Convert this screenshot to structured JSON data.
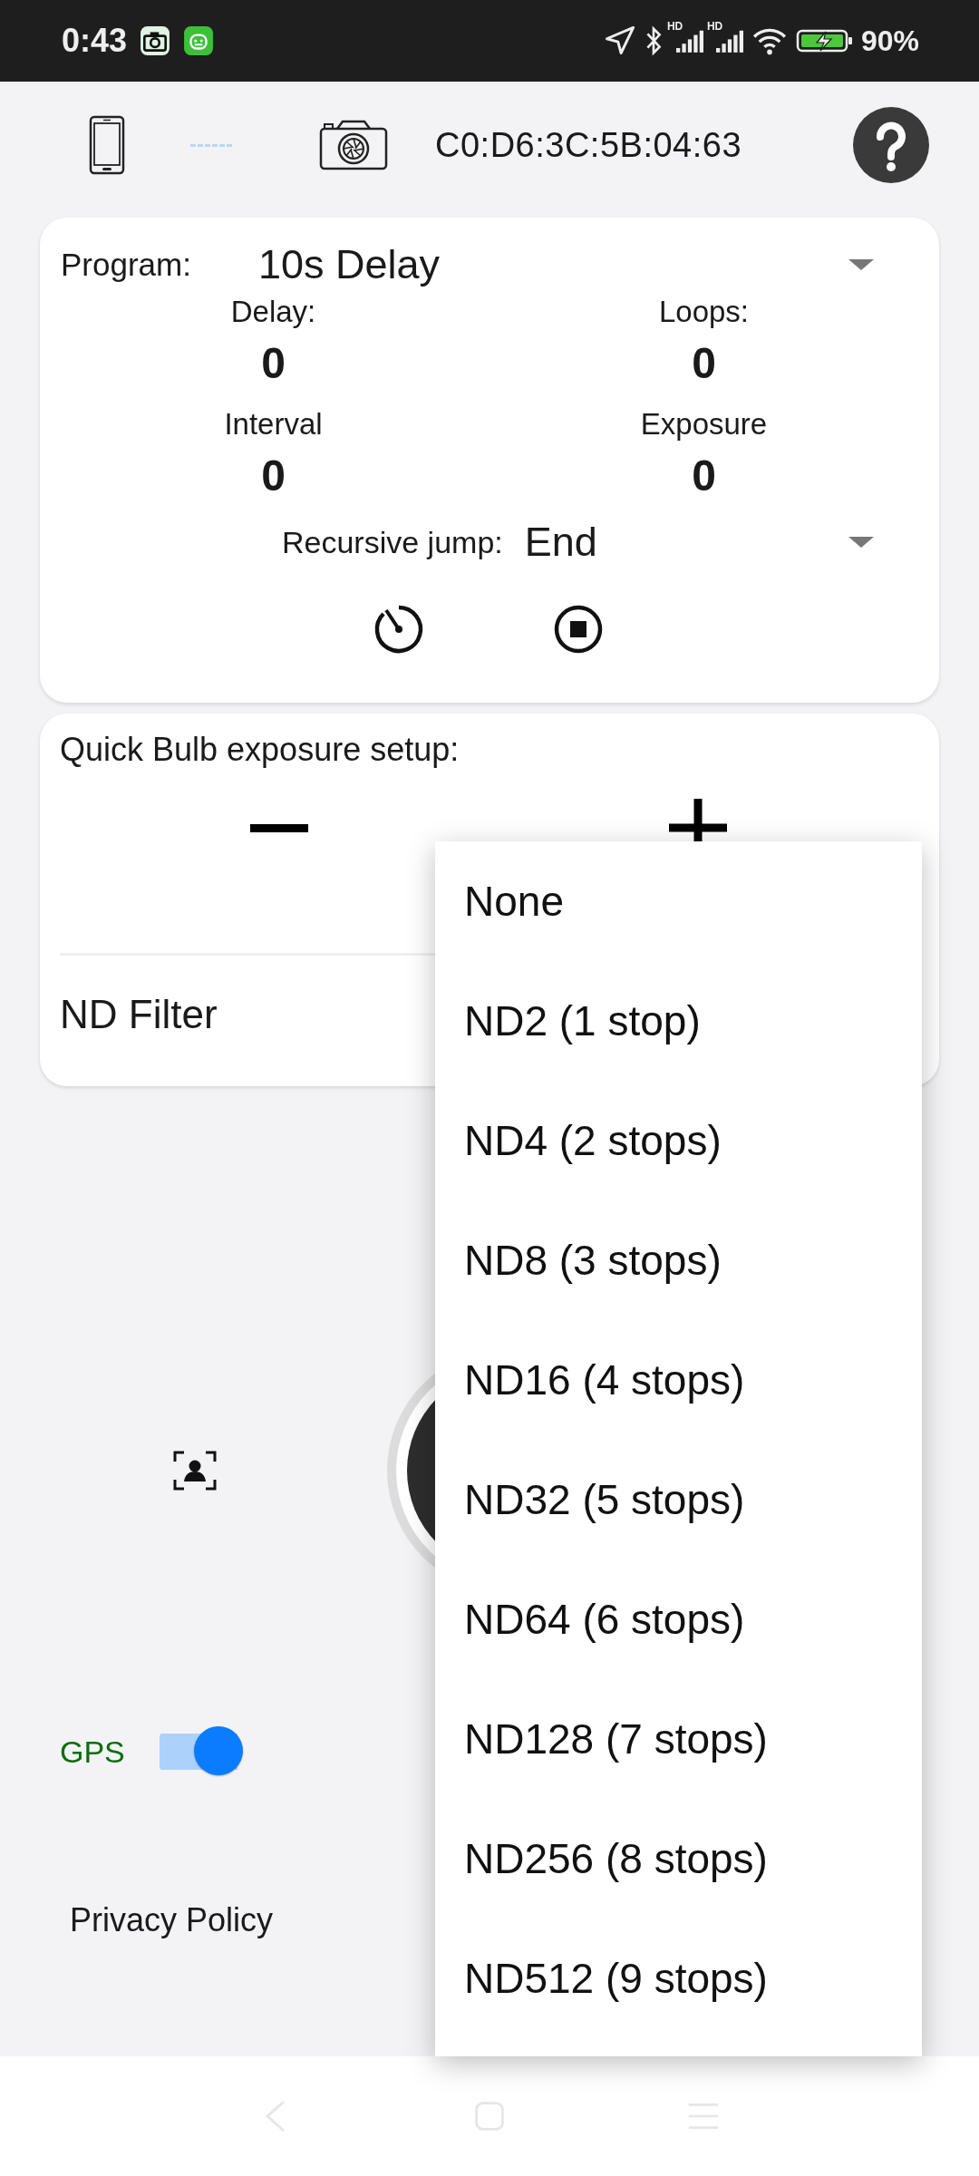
{
  "status_bar": {
    "time": "0:43",
    "signal_labels": [
      "HD",
      "HD"
    ],
    "battery": "90%"
  },
  "header": {
    "device_address": "C0:D6:3C:5B:04:63",
    "connected": false
  },
  "program_card": {
    "program_label": "Program:",
    "program_value": "10s Delay",
    "jump_label": "Recursive jump:",
    "jump_value": "End",
    "fields": [
      {
        "label": "Delay:",
        "value": "0"
      },
      {
        "label": "Loops:",
        "value": "0"
      },
      {
        "label": "Interval",
        "value": "0"
      },
      {
        "label": "Exposure",
        "value": "0"
      }
    ]
  },
  "bulb_card": {
    "title": "Quick Bulb exposure setup:",
    "nd_label": "ND Filter"
  },
  "gps": {
    "label": "GPS",
    "on": true
  },
  "privacy_link": "Privacy Policy",
  "nd_menu": {
    "items": [
      {
        "label": "None"
      },
      {
        "label": "ND2 (1 stop)"
      },
      {
        "label": "ND4 (2 stops)"
      },
      {
        "label": "ND8 (3 stops)"
      },
      {
        "label": "ND16 (4 stops)"
      },
      {
        "label": "ND32 (5 stops)"
      },
      {
        "label": "ND64 (6 stops)"
      },
      {
        "label": "ND128 (7 stops)"
      },
      {
        "label": "ND256 (8 stops)"
      },
      {
        "label": "ND512 (9 stops)"
      }
    ]
  }
}
